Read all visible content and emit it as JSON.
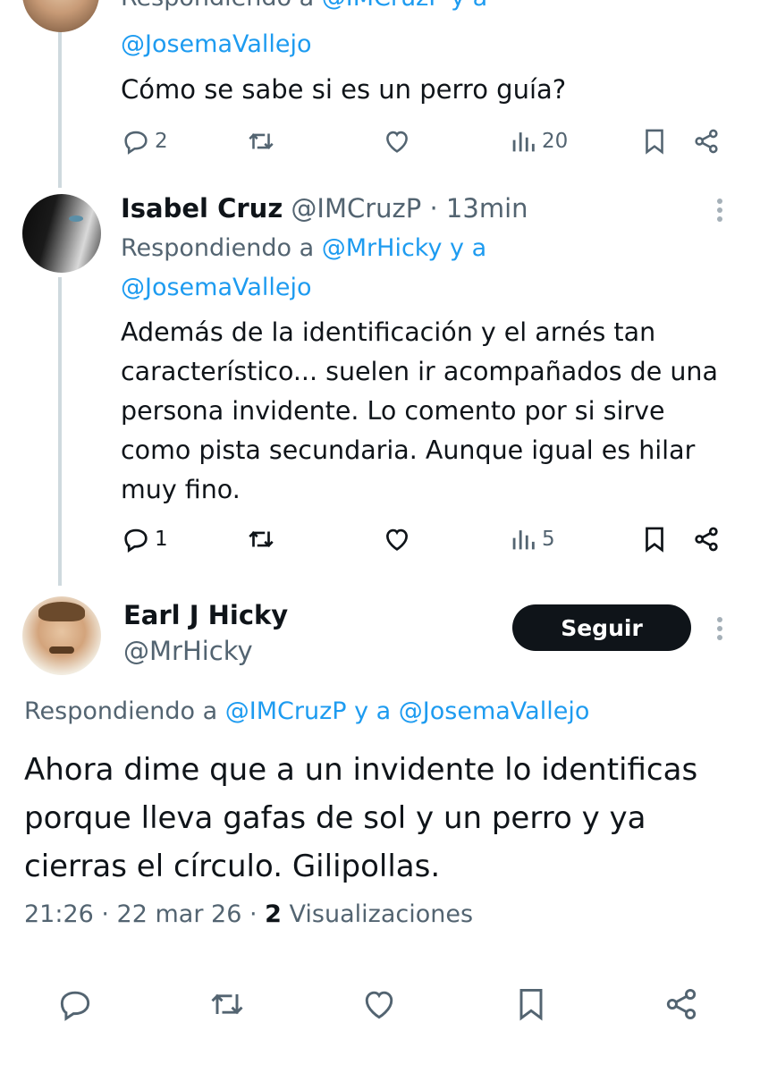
{
  "reply1": {
    "replying_prefix": "Respondiendo a",
    "replying_handles": "@IMCruzP y a",
    "replying_handle2": "@JosemaVallejo",
    "text": "Cómo se sabe si es un perro guía?",
    "replies": "2",
    "views": "20"
  },
  "reply2": {
    "name": "Isabel Cruz",
    "handle": "@IMCruzP",
    "separator": "·",
    "time": "13min",
    "replying_prefix": "Respondiendo a",
    "replying_handles": "@MrHicky y a",
    "replying_handle2": "@JosemaVallejo",
    "text_lines": [
      "Además de la identificación y el arnés tan",
      "característico... suelen ir acompañados de una",
      "persona invidente. Lo comento por si sirve",
      "como pista secundaria. Aunque igual es hilar",
      "muy fino."
    ],
    "replies": "1",
    "views": "5"
  },
  "main": {
    "name": "Earl J Hicky",
    "handle": "@MrHicky",
    "follow_label": "Seguir",
    "replying_prefix": "Respondiendo a",
    "replying_handles": "@IMCruzP y a @JosemaVallejo",
    "text_lines": [
      "Ahora dime que a un invidente lo identificas",
      "porque lleva gafas de sol y un perro y ya",
      "cierras el círculo. Gilipollas."
    ],
    "timestamp": "21:26 · 22 mar 26 ·",
    "views_count": "2",
    "views_label": "Visualizaciones"
  },
  "icons": {
    "reply": "reply-icon",
    "retweet": "retweet-icon",
    "like": "heart-icon",
    "views": "views-icon",
    "bookmark": "bookmark-icon",
    "share": "share-icon"
  },
  "colors": {
    "link": "#1d9bf0",
    "muted": "#536471",
    "text": "#0f1419",
    "thread_line": "#cfd9de"
  }
}
